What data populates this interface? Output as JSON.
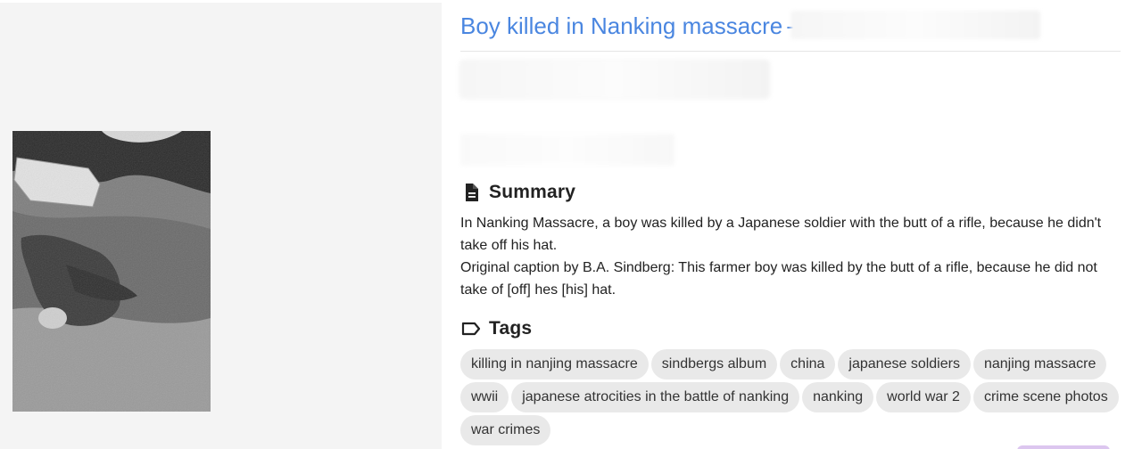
{
  "page": {
    "title": "Boy killed in Nanking massacre",
    "title_separator": "-"
  },
  "summary": {
    "heading": "Summary",
    "icon": "document-icon",
    "paragraphs": [
      "In Nanking Massacre, a boy was killed by a Japanese soldier with the butt of a rifle, because he didn't take off his hat.",
      "Original caption by B.A. Sindberg: This farmer boy was killed by the butt of a rifle, because he did not take of [off] hes [his] hat."
    ]
  },
  "tags": {
    "heading": "Tags",
    "icon": "tag-icon",
    "items": [
      "killing in nanjing massacre",
      "sindbergs album",
      "china",
      "japanese soldiers",
      "nanjing massacre",
      "wwii",
      "japanese atrocities in the battle of nanking",
      "nanking",
      "world war 2",
      "crime scene photos",
      "war crimes"
    ]
  },
  "colors": {
    "title": "#4a86e0",
    "tag_bg": "#e9e9e9",
    "left_bg": "#f4f4f4"
  }
}
